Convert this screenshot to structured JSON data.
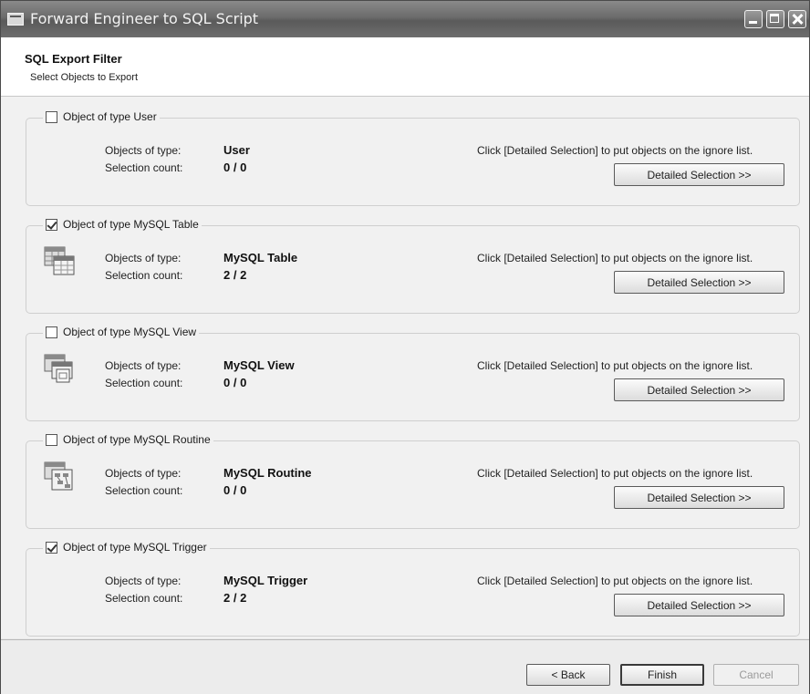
{
  "window": {
    "title": "Forward Engineer to SQL Script"
  },
  "header": {
    "title": "SQL Export Filter",
    "subtitle": "Select Objects to Export"
  },
  "groups": [
    {
      "legend": "Object of type User",
      "checked": false,
      "icon": "none",
      "type_label": "Objects of type:",
      "type_value": "User",
      "count_label": "Selection count:",
      "count_value": "0 / 0",
      "hint": "Click [Detailed Selection] to put objects on the ignore list.",
      "button": "Detailed Selection >>"
    },
    {
      "legend": "Object of type MySQL Table",
      "checked": true,
      "icon": "table-icon",
      "type_label": "Objects of type:",
      "type_value": "MySQL Table",
      "count_label": "Selection count:",
      "count_value": "2 / 2",
      "hint": "Click [Detailed Selection] to put objects on the ignore list.",
      "button": "Detailed Selection >>"
    },
    {
      "legend": "Object of type MySQL View",
      "checked": false,
      "icon": "view-icon",
      "type_label": "Objects of type:",
      "type_value": "MySQL View",
      "count_label": "Selection count:",
      "count_value": "0 / 0",
      "hint": "Click [Detailed Selection] to put objects on the ignore list.",
      "button": "Detailed Selection >>"
    },
    {
      "legend": "Object of type MySQL Routine",
      "checked": false,
      "icon": "routine-icon",
      "type_label": "Objects of type:",
      "type_value": "MySQL Routine",
      "count_label": "Selection count:",
      "count_value": "0 / 0",
      "hint": "Click [Detailed Selection] to put objects on the ignore list.",
      "button": "Detailed Selection >>"
    },
    {
      "legend": "Object of type MySQL Trigger",
      "checked": true,
      "icon": "none",
      "type_label": "Objects of type:",
      "type_value": "MySQL Trigger",
      "count_label": "Selection count:",
      "count_value": "2 / 2",
      "hint": "Click [Detailed Selection] to put objects on the ignore list.",
      "button": "Detailed Selection >>"
    }
  ],
  "footer": {
    "back": "< Back",
    "finish": "Finish",
    "cancel": "Cancel",
    "cancel_enabled": false
  }
}
